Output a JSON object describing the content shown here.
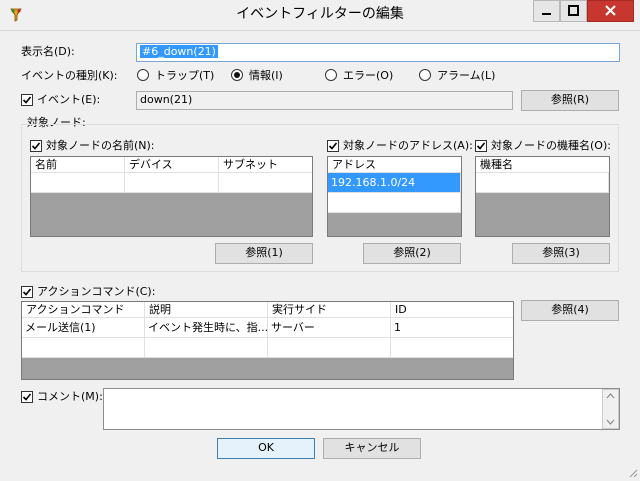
{
  "window": {
    "title": "イベントフィルターの編集",
    "minimize": "—",
    "maximize": "☐",
    "close": "✕"
  },
  "display_name": {
    "label": "表示名(D):",
    "value": "#6_down(21)"
  },
  "event_type": {
    "label": "イベントの種別(K):",
    "options": [
      {
        "label": "トラップ(T)",
        "selected": false
      },
      {
        "label": "情報(I)",
        "selected": true
      },
      {
        "label": "エラー(O)",
        "selected": false
      },
      {
        "label": "アラーム(L)",
        "selected": false
      }
    ]
  },
  "event": {
    "label": "イベント(E):",
    "checked": true,
    "value": "down(21)",
    "browse": "参照(R)"
  },
  "target_node": {
    "group_label": "対象ノード:",
    "name": {
      "label": "対象ノードの名前(N):",
      "checked": true,
      "columns": [
        "名前",
        "デバイス",
        "サブネット"
      ],
      "rows": [],
      "browse": "参照(1)"
    },
    "address": {
      "label": "対象ノードのアドレス(A):",
      "checked": true,
      "columns": [
        "アドレス"
      ],
      "rows": [
        "192.168.1.0/24"
      ],
      "browse": "参照(2)"
    },
    "model": {
      "label": "対象ノードの機種名(O):",
      "checked": true,
      "columns": [
        "機種名"
      ],
      "rows": [],
      "browse": "参照(3)"
    }
  },
  "action_command": {
    "label": "アクションコマンド(C):",
    "checked": true,
    "columns": [
      "アクションコマンド",
      "説明",
      "実行サイド",
      "ID"
    ],
    "rows": [
      [
        "メール送信(1)",
        "イベント発生時に、指...",
        "サーバー",
        "1"
      ]
    ],
    "browse": "参照(4)"
  },
  "comment": {
    "label": "コメント(M):",
    "checked": true,
    "value": ""
  },
  "buttons": {
    "ok": "OK",
    "cancel": "キャンセル"
  },
  "colors": {
    "accent": "#3399ff",
    "close": "#c7372f"
  }
}
